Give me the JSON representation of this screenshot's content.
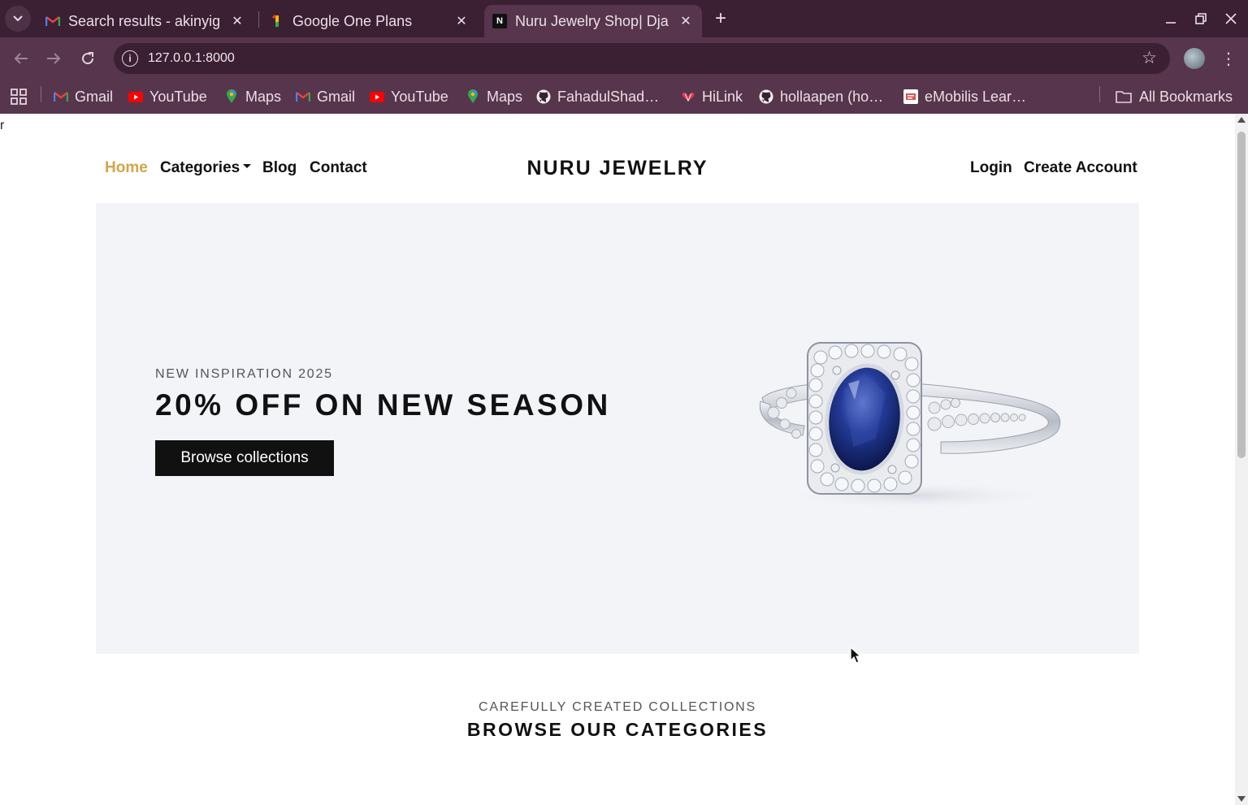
{
  "browser": {
    "tabs": [
      {
        "title": "Search results - akinyig",
        "favicon": "gmail-icon"
      },
      {
        "title": "Google One Plans",
        "favicon": "google-one-icon"
      },
      {
        "title": "Nuru Jewelry Shop| Dja",
        "favicon": "site-icon"
      }
    ],
    "url": "127.0.0.1:8000",
    "bookmarks": [
      {
        "label": "Gmail",
        "icon": "gmail-icon"
      },
      {
        "label": "YouTube",
        "icon": "youtube-icon"
      },
      {
        "label": "Maps",
        "icon": "maps-icon"
      },
      {
        "label": "Gmail",
        "icon": "gmail-icon"
      },
      {
        "label": "YouTube",
        "icon": "youtube-icon"
      },
      {
        "label": "Maps",
        "icon": "maps-icon"
      },
      {
        "label": "FahadulShad…",
        "icon": "github-icon"
      },
      {
        "label": "HiLink",
        "icon": "hilink-icon"
      },
      {
        "label": "hollaapen (ho…",
        "icon": "github-icon"
      },
      {
        "label": "eMobilis Lear…",
        "icon": "emobilis-icon"
      }
    ],
    "all_bookmarks": "All Bookmarks"
  },
  "page": {
    "stray_text": "r",
    "nav": {
      "home": "Home",
      "categories": "Categories",
      "blog": "Blog",
      "contact": "Contact",
      "brand": "NURU JEWELRY",
      "login": "Login",
      "create_account": "Create Account"
    },
    "hero": {
      "subtitle": "NEW INSPIRATION 2025",
      "title": "20% OFF ON NEW SEASON",
      "button": "Browse collections"
    },
    "section": {
      "subtitle": "CAREFULLY CREATED COLLECTIONS",
      "title": "BROWSE OUR CATEGORIES"
    }
  },
  "colors": {
    "chrome_dark": "#3b1f33",
    "chrome_light": "#57354c",
    "accent_active_nav": "#d2a54a",
    "hero_bg": "#f3f4f8",
    "button_bg": "#111111"
  }
}
